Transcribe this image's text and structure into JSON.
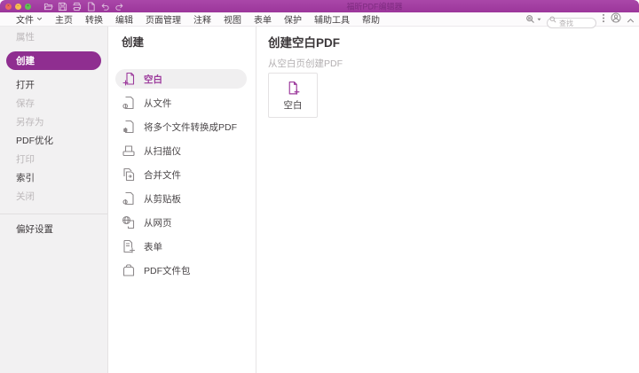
{
  "window": {
    "title": "福昕PDF编辑器"
  },
  "titlebar": {
    "traffic_lights": {
      "close": "×",
      "minimize": "−",
      "zoom": "+"
    },
    "quick_access_icons": [
      "open-folder",
      "save",
      "print",
      "new-document",
      "undo",
      "redo"
    ]
  },
  "menubar": {
    "items": [
      {
        "label": "文件",
        "has_caret": true
      },
      {
        "label": "主页"
      },
      {
        "label": "转换"
      },
      {
        "label": "编辑"
      },
      {
        "label": "页面管理"
      },
      {
        "label": "注释"
      },
      {
        "label": "视图"
      },
      {
        "label": "表单"
      },
      {
        "label": "保护"
      },
      {
        "label": "辅助工具"
      },
      {
        "label": "帮助"
      }
    ],
    "search": {
      "placeholder": "查找"
    }
  },
  "backstage": {
    "sidebar": {
      "items": [
        {
          "label": "属性",
          "state": "disabled"
        },
        {
          "label": "创建",
          "state": "selected"
        },
        {
          "label": "打开",
          "state": "enabled"
        },
        {
          "label": "保存",
          "state": "disabled"
        },
        {
          "label": "另存为",
          "state": "disabled"
        },
        {
          "label": "PDF优化",
          "state": "enabled"
        },
        {
          "label": "打印",
          "state": "disabled"
        },
        {
          "label": "索引",
          "state": "enabled"
        },
        {
          "label": "关闭",
          "state": "disabled"
        }
      ],
      "footer_item": {
        "label": "偏好设置",
        "state": "enabled"
      }
    },
    "create_panel": {
      "title": "创建",
      "items": [
        {
          "label": "空白",
          "icon": "blank-page-icon",
          "selected": true
        },
        {
          "label": "从文件",
          "icon": "from-file-icon",
          "selected": false
        },
        {
          "label": "将多个文件转换成PDF",
          "icon": "multiple-files-icon",
          "selected": false
        },
        {
          "label": "从扫描仪",
          "icon": "scanner-icon",
          "selected": false
        },
        {
          "label": "合并文件",
          "icon": "combine-files-icon",
          "selected": false
        },
        {
          "label": "从剪贴板",
          "icon": "clipboard-icon",
          "selected": false
        },
        {
          "label": "从网页",
          "icon": "webpage-icon",
          "selected": false
        },
        {
          "label": "表单",
          "icon": "form-icon",
          "selected": false
        },
        {
          "label": "PDF文件包",
          "icon": "portfolio-icon",
          "selected": false
        }
      ]
    },
    "content": {
      "title": "创建空白PDF",
      "subtitle": "从空白页创建PDF",
      "card": {
        "label": "空白"
      }
    }
  },
  "colors": {
    "titlebar": "#9c369b",
    "accent": "#9c3a9c",
    "selected_pill": "#8f2e90",
    "sidebar_bg": "#f2f1f2"
  }
}
